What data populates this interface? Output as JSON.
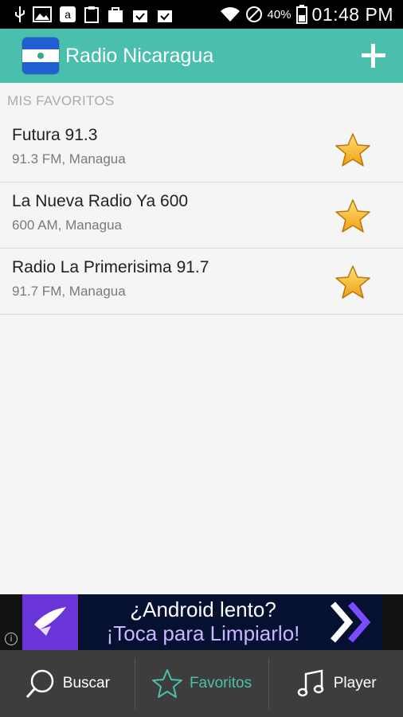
{
  "status_bar": {
    "battery_percent": "40%",
    "time": "01:48 PM",
    "icons": [
      "usb-icon",
      "image-icon",
      "amazon-icon",
      "clipboard-icon",
      "bag-icon",
      "bag-check-icon",
      "bag-check-icon",
      "wifi-icon",
      "do-not-disturb-icon",
      "battery-icon"
    ]
  },
  "app_bar": {
    "title": "Radio Nicaragua",
    "add_icon": "plus-icon",
    "logo": "nicaragua-flag-icon"
  },
  "favorites": {
    "section_title": "MIS FAVORITOS",
    "stations": [
      {
        "name": "Futura 91.3",
        "subtitle": "91.3 FM, Managua"
      },
      {
        "name": "La Nueva Radio Ya 600",
        "subtitle": "600 AM, Managua"
      },
      {
        "name": "Radio La Primerisima 91.7",
        "subtitle": "91.7 FM, Managua"
      }
    ]
  },
  "ad": {
    "line1": "¿Android lento?",
    "line2": "¡Toca para Limpiarlo!",
    "info_icon": "info-icon"
  },
  "bottom_nav": {
    "items": [
      {
        "label": "Buscar",
        "icon": "search-icon"
      },
      {
        "label": "Favoritos",
        "icon": "star-outline-icon"
      },
      {
        "label": "Player",
        "icon": "music-note-icon"
      }
    ]
  },
  "colors": {
    "accent": "#4bbfae",
    "star": "#f5b624",
    "nav_background": "#3d3d3d"
  }
}
